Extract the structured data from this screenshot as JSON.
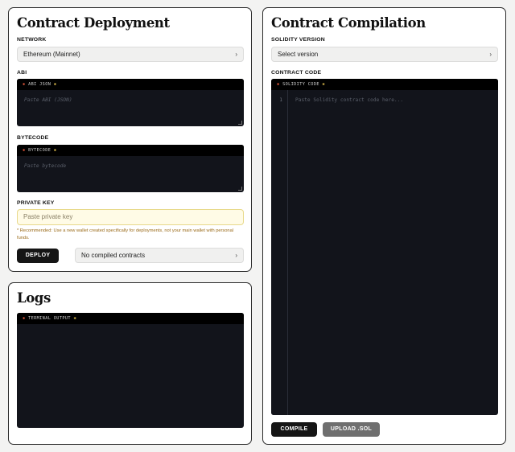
{
  "deployment": {
    "title": "Contract Deployment",
    "network_label": "NETWORK",
    "network_value": "Ethereum (Mainnet)",
    "abi_label": "ABI",
    "abi_header": "ABI JSON",
    "abi_placeholder": "Paste ABI (JSON)",
    "bytecode_label": "BYTECODE",
    "bytecode_header": "BYTECODE",
    "bytecode_placeholder": "Paste bytecode",
    "private_key_label": "PRIVATE KEY",
    "private_key_placeholder": "Paste private key",
    "warning": "* Recommended: Use a new wallet created specifically for deployments, not your main wallet with personal funds.",
    "deploy_button": "DEPLOY",
    "compiled_select": "No compiled contracts"
  },
  "logs": {
    "title": "Logs",
    "terminal_header": "TERMINAL OUTPUT"
  },
  "compilation": {
    "title": "Contract Compilation",
    "version_label": "SOLIDITY VERSION",
    "version_value": "Select version",
    "code_label": "CONTRACT CODE",
    "code_header": "SOLIDITY CODE",
    "line_number": "1",
    "code_placeholder": "Paste Solidity contract code here...",
    "compile_button": "COMPILE",
    "upload_button": "UPLOAD .SOL"
  },
  "icons": {
    "chevron": "chevron-right-icon",
    "asterisk": "asterisk-icon"
  },
  "colors": {
    "terminal_bg": "#12141b",
    "asterisk_red": "#e2573b",
    "asterisk_yellow": "#d9b84a",
    "warning_text": "#9a6a18",
    "private_key_bg": "#fffbe6"
  }
}
